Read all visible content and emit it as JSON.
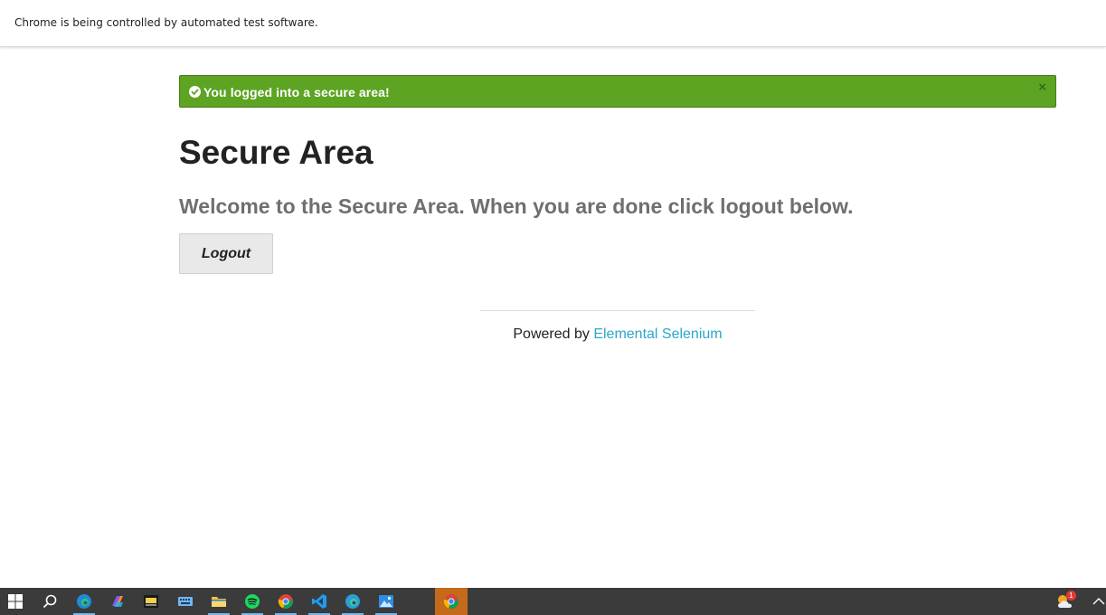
{
  "browser": {
    "infobar_text": "Chrome is being controlled by automated test software."
  },
  "flash": {
    "message": "You logged into a secure area!",
    "close_label": "×",
    "color": "#5da423"
  },
  "page": {
    "title": "Secure Area",
    "subheader": "Welcome to the Secure Area. When you are done click logout below.",
    "logout_label": "Logout"
  },
  "footer": {
    "prefix": "Powered by ",
    "link_text": "Elemental Selenium",
    "link_color": "#2ba6cb"
  },
  "taskbar": {
    "items": [
      {
        "name": "windows-start-icon"
      },
      {
        "name": "search-icon"
      },
      {
        "name": "edge-icon",
        "running": true
      },
      {
        "name": "copilot-icon"
      },
      {
        "name": "game-app-icon"
      },
      {
        "name": "keyboard-icon"
      },
      {
        "name": "file-explorer-icon",
        "running": true
      },
      {
        "name": "spotify-icon",
        "running": true
      },
      {
        "name": "chrome-icon",
        "running": true
      },
      {
        "name": "vscode-icon",
        "running": true
      },
      {
        "name": "edge-dev-icon",
        "running": true
      },
      {
        "name": "photos-icon",
        "running": true
      },
      {
        "name": "chrome-active-icon",
        "active": true
      }
    ],
    "tray": {
      "weather_badge": "1",
      "icons": [
        "weather-icon",
        "chevron-up-icon"
      ]
    }
  }
}
